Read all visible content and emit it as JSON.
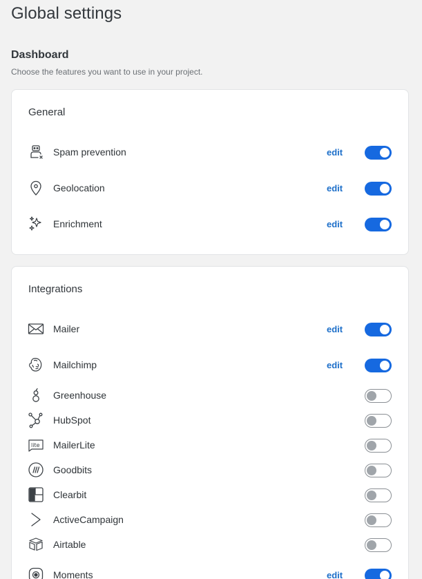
{
  "page": {
    "title": "Global settings",
    "section_title": "Dashboard",
    "section_desc": "Choose the features you want to use in your project."
  },
  "general": {
    "title": "General",
    "items": [
      {
        "label": "Spam prevention",
        "icon": "robot-icon",
        "edit": "edit",
        "enabled": true
      },
      {
        "label": "Geolocation",
        "icon": "map-pin-icon",
        "edit": "edit",
        "enabled": true
      },
      {
        "label": "Enrichment",
        "icon": "sparkles-icon",
        "edit": "edit",
        "enabled": true
      }
    ]
  },
  "integrations": {
    "title": "Integrations",
    "items": [
      {
        "label": "Mailer",
        "icon": "envelope-icon",
        "edit": "edit",
        "enabled": true
      },
      {
        "label": "Mailchimp",
        "icon": "mailchimp-icon",
        "edit": "edit",
        "enabled": true
      },
      {
        "label": "Greenhouse",
        "icon": "greenhouse-icon",
        "enabled": false
      },
      {
        "label": "HubSpot",
        "icon": "hubspot-icon",
        "enabled": false
      },
      {
        "label": "MailerLite",
        "icon": "mailerlite-icon",
        "enabled": false
      },
      {
        "label": "Goodbits",
        "icon": "goodbits-icon",
        "enabled": false
      },
      {
        "label": "Clearbit",
        "icon": "clearbit-icon",
        "enabled": false
      },
      {
        "label": "ActiveCampaign",
        "icon": "activecampaign-icon",
        "enabled": false
      },
      {
        "label": "Airtable",
        "icon": "airtable-icon",
        "enabled": false
      },
      {
        "label": "Moments",
        "icon": "moments-icon",
        "edit": "edit",
        "enabled": true
      }
    ]
  },
  "colors": {
    "toggle_on": "#1669e0",
    "edit_link": "#1d6fc9",
    "background": "#f2f2f2"
  }
}
